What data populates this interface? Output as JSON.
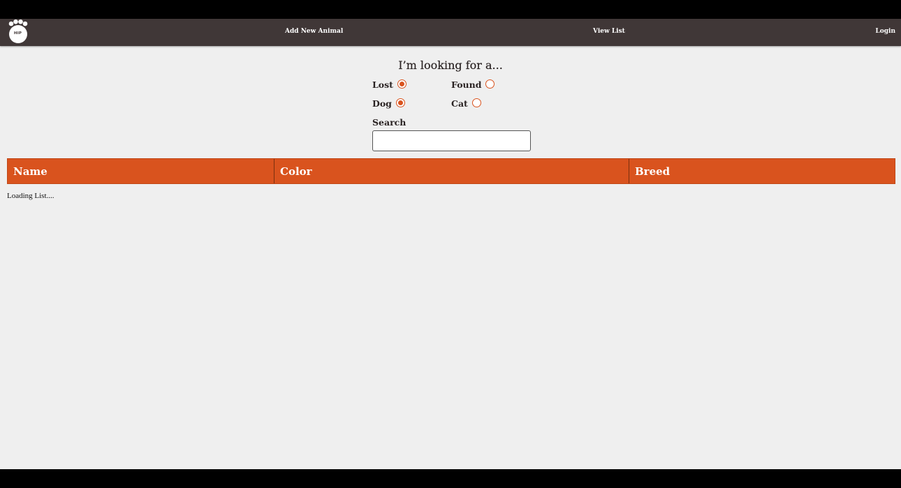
{
  "brand": {
    "logo_text": "HIP",
    "nav_color": "#403737",
    "accent_color": "#d9531e"
  },
  "nav": {
    "add_new_animal": "Add New Animal",
    "view_list": "View List",
    "login": "Login"
  },
  "search_form": {
    "heading": "I’m looking for a...",
    "status_options": [
      {
        "label": "Lost",
        "checked": true
      },
      {
        "label": "Found",
        "checked": false
      }
    ],
    "animal_options": [
      {
        "label": "Dog",
        "checked": true
      },
      {
        "label": "Cat",
        "checked": false
      }
    ],
    "search_label": "Search",
    "search_value": ""
  },
  "table": {
    "columns": [
      "Name",
      "Color",
      "Breed"
    ],
    "status_text": "Loading List...."
  }
}
